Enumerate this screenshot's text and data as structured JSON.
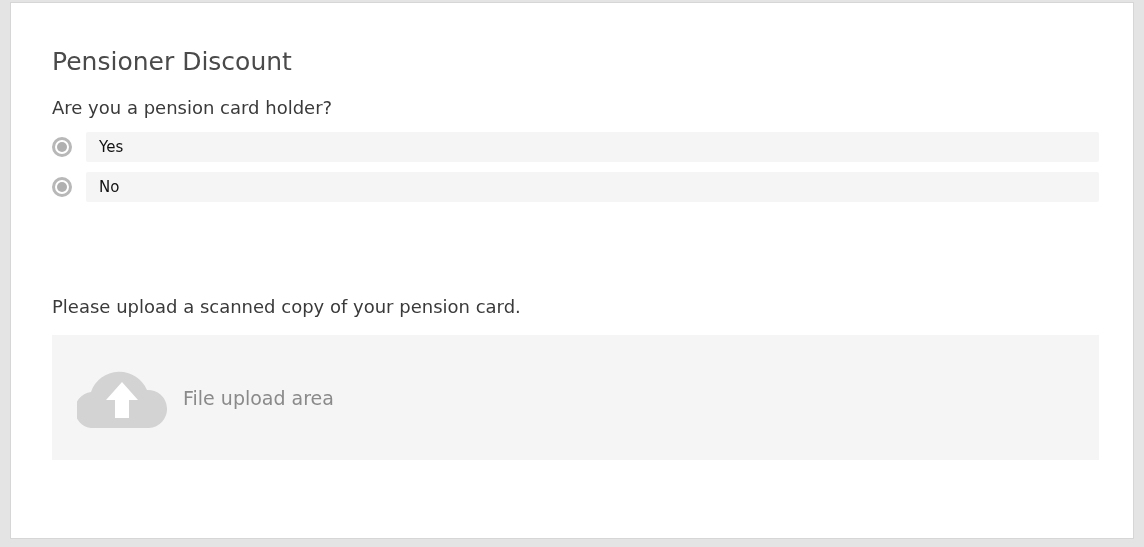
{
  "title": "Pensioner Discount",
  "question": "Are you a pension card holder?",
  "options": [
    {
      "label": "Yes",
      "selected": true,
      "disabled": true
    },
    {
      "label": "No",
      "selected": true,
      "disabled": true
    }
  ],
  "upload": {
    "prompt": "Please upload a scanned copy of your pension card.",
    "label": "File upload area"
  }
}
